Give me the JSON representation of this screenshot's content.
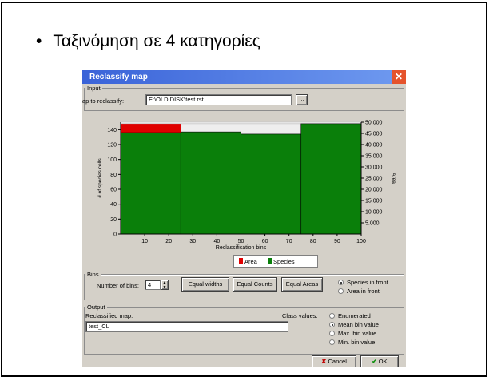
{
  "slide": {
    "bullet": "Ταξινόμηση σε 4 κατηγορίες"
  },
  "dialog": {
    "title": "Reclassify map",
    "close_glyph": "✕",
    "input_group": "Input",
    "map_label": "ap to reclassify:",
    "map_value": "E:\\OLD DISK\\test.rst",
    "browse_label": "...",
    "bins_group": "Bins",
    "num_bins_label": "Number of bins:",
    "num_bins_value": "4",
    "equal_widths": "Equal widths",
    "equal_counts": "Equal Counts",
    "equal_areas": "Equal Areas",
    "front_options": [
      {
        "label": "Species in front",
        "selected": true
      },
      {
        "label": "Area in front",
        "selected": false
      }
    ],
    "output_group": "Output",
    "reclassified_label": "Reclassified map:",
    "reclassified_value": "test_CL",
    "class_values_label": "Class values:",
    "class_options": [
      {
        "label": "Enumerated",
        "selected": false
      },
      {
        "label": "Mean bin value",
        "selected": true
      },
      {
        "label": "Max. bin value",
        "selected": false
      },
      {
        "label": "Min. bin value",
        "selected": false
      }
    ],
    "cancel_label": "Cancel",
    "ok_label": "OK",
    "colors": {
      "species": "#0a7f0a",
      "area": "#e00000",
      "titlebar": "#3a63d8"
    }
  },
  "chart_data": {
    "type": "bar",
    "xlabel": "Reclassification bins",
    "ylabel_left": "# of species cells",
    "ylabel_right": "Area",
    "x_ticks": [
      "10",
      "20",
      "30",
      "40",
      "50",
      "60",
      "70",
      "80",
      "90",
      "100"
    ],
    "y_left_ticks": [
      "0",
      "20",
      "40",
      "60",
      "80",
      "100",
      "120",
      "140"
    ],
    "y_right_ticks": [
      "5.000",
      "10.000",
      "15.000",
      "20.000",
      "25.000",
      "30.000",
      "35.000",
      "40.000",
      "45.000",
      "50.000"
    ],
    "xlim": [
      0,
      100
    ],
    "ylim_left": [
      0,
      150
    ],
    "ylim_right": [
      0,
      50000
    ],
    "bins": [
      {
        "x0": 0,
        "x1": 25,
        "species": 136,
        "area": 148
      },
      {
        "x0": 25,
        "x1": 50,
        "species": 137,
        "area": 148
      },
      {
        "x0": 50,
        "x1": 75,
        "species": 134,
        "area": 148
      },
      {
        "x0": 75,
        "x1": 100,
        "species": 148,
        "area": 148
      }
    ],
    "legend": [
      {
        "name": "Area",
        "color": "#e00000"
      },
      {
        "name": "Species",
        "color": "#0a7f0a"
      }
    ],
    "legend_position": "bottom"
  }
}
